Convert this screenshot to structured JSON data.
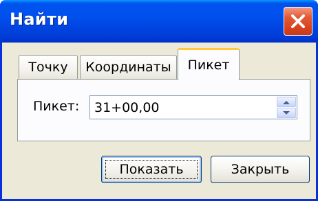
{
  "window": {
    "title": "Найти"
  },
  "tabs": [
    {
      "label": "Точку",
      "active": false
    },
    {
      "label": "Координаты",
      "active": false
    },
    {
      "label": "Пикет",
      "active": true
    }
  ],
  "form": {
    "picket_label": "Пикет:",
    "picket_value": "31+00,00"
  },
  "buttons": {
    "show_label": "Показать",
    "close_label": "Закрыть"
  },
  "icons": {
    "close": "close-icon",
    "spin_up": "arrow-up-icon",
    "spin_down": "arrow-down-icon"
  },
  "colors": {
    "titlebar": "#0050ee",
    "close_button": "#d8461f",
    "active_tab_accent": "#ffc83c",
    "window_background": "#ece9d8"
  }
}
